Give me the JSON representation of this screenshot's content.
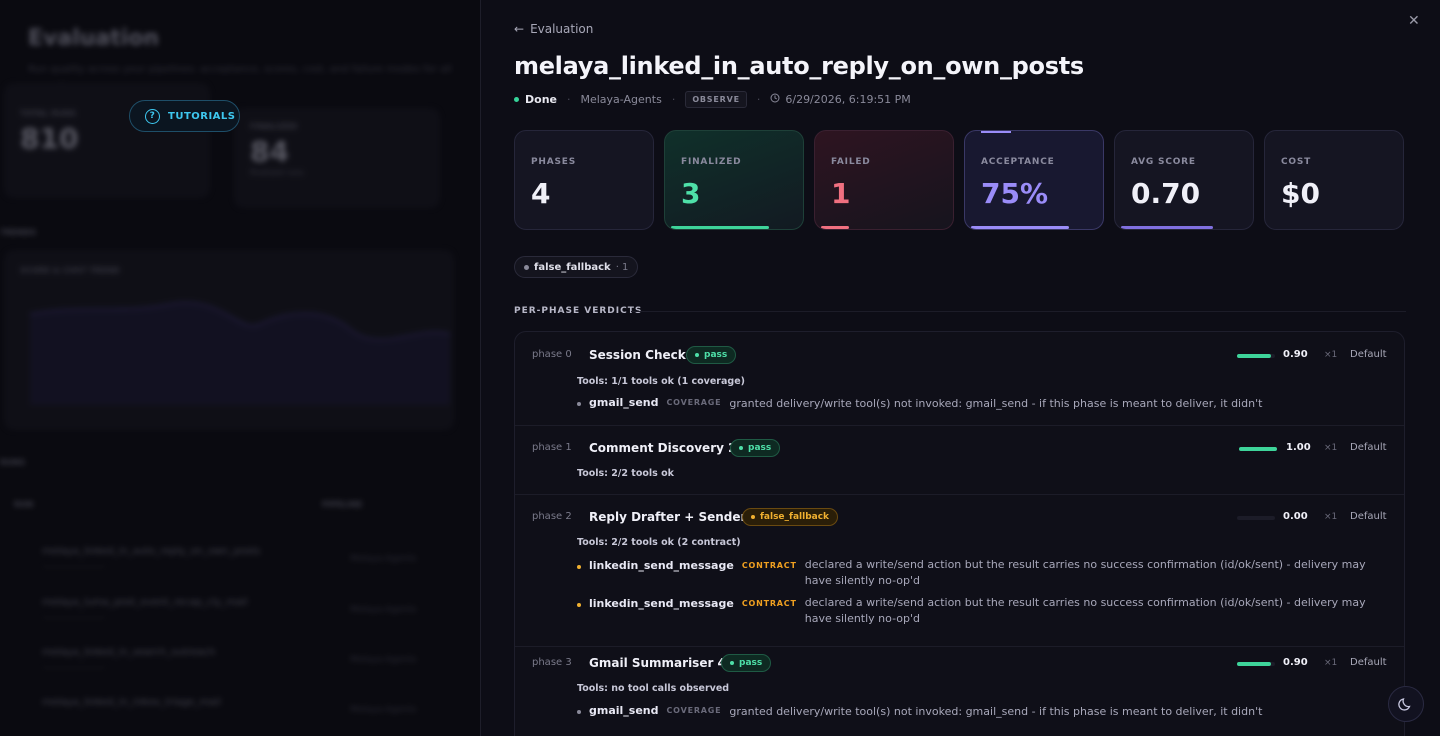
{
  "background": {
    "title": "Evaluation",
    "subtitle": "Run quality across your pipelines: acceptance, scores, cost, and failure modes for all executions",
    "tutorials_label": "TUTORIALS",
    "cards": [
      {
        "label": "TOTAL RUNS",
        "value": "810"
      },
      {
        "label": "FINALIZED",
        "value": "84",
        "sub": "finalized runs"
      }
    ],
    "trends_label": "TRENDS",
    "chart_label": "SCORE & COST TREND",
    "runs_label": "RUNS",
    "runs_columns": [
      "RUN",
      "PIPELINE"
    ],
    "runs": [
      {
        "name": "melaya_linked_in_auto_reply_on_own_posts",
        "pipeline": "Melaya-Agents"
      },
      {
        "name": "melaya_luma_post_event_recap_cly_mail",
        "pipeline": "Melaya-Agents"
      },
      {
        "name": "melaya_linked_in_search_outreach",
        "pipeline": "Melaya-Agents"
      },
      {
        "name": "melaya_linked_in_inbox_triage_mail",
        "pipeline": "Melaya-Agents"
      }
    ]
  },
  "panel": {
    "back_label": "Evaluation",
    "title": "melaya_linked_in_auto_reply_on_own_posts",
    "status": "Done",
    "pipeline": "Melaya-Agents",
    "mode": "OBSERVE",
    "timestamp": "6/29/2026, 6:19:51 PM",
    "cards": [
      {
        "label": "PHASES",
        "value": "4"
      },
      {
        "label": "FINALIZED",
        "value": "3"
      },
      {
        "label": "FAILED",
        "value": "1"
      },
      {
        "label": "ACCEPTANCE",
        "value": "75%"
      },
      {
        "label": "AVG SCORE",
        "value": "0.70"
      },
      {
        "label": "COST",
        "value": "$0"
      }
    ],
    "tag": {
      "label": "false_fallback",
      "count": "· 1"
    },
    "section_title": "PER-PHASE VERDICTS",
    "phases": [
      {
        "label": "phase 0",
        "name": "Session Check",
        "verdict": "pass",
        "score": "0.90",
        "score_value": 0.9,
        "mult": "×1",
        "policy": "Default",
        "tools": "Tools: 1/1 tools ok (1 coverage)",
        "issues": [
          {
            "tool": "gmail_send",
            "kind": "COVERAGE",
            "msg": "granted delivery/write tool(s) not invoked: gmail_send - if this phase is meant to deliver, it didn't"
          }
        ]
      },
      {
        "label": "phase 1",
        "name": "Comment Discovery 2",
        "verdict": "pass",
        "score": "1.00",
        "score_value": 1.0,
        "mult": "×1",
        "policy": "Default",
        "tools": "Tools: 2/2 tools ok",
        "issues": []
      },
      {
        "label": "phase 2",
        "name": "Reply Drafter + Sender 3",
        "verdict": "false_fallback",
        "score": "0.00",
        "score_value": 0.0,
        "mult": "×1",
        "policy": "Default",
        "tools": "Tools: 2/2 tools ok (2 contract)",
        "issues": [
          {
            "tool": "linkedin_send_message",
            "kind": "CONTRACT",
            "msg": "declared a write/send action but the result carries no success confirmation (id/ok/sent) - delivery may have silently no-op'd"
          },
          {
            "tool": "linkedin_send_message",
            "kind": "CONTRACT",
            "msg": "declared a write/send action but the result carries no success confirmation (id/ok/sent) - delivery may have silently no-op'd"
          }
        ]
      },
      {
        "label": "phase 3",
        "name": "Gmail Summariser 4",
        "verdict": "pass",
        "score": "0.90",
        "score_value": 0.9,
        "mult": "×1",
        "policy": "Default",
        "tools": "Tools: no tool calls observed",
        "issues": [
          {
            "tool": "gmail_send",
            "kind": "COVERAGE",
            "msg": "granted delivery/write tool(s) not invoked: gmail_send - if this phase is meant to deliver, it didn't"
          }
        ]
      }
    ]
  },
  "icons": {
    "back": "arrow-left-icon",
    "close": "close-icon",
    "clock": "clock-icon",
    "theme": "moon-icon"
  },
  "colors": {
    "pass": "#4ee0a8",
    "fallback": "#f0b030",
    "acceptance": "#9a8cf8",
    "failed": "#f07080"
  }
}
